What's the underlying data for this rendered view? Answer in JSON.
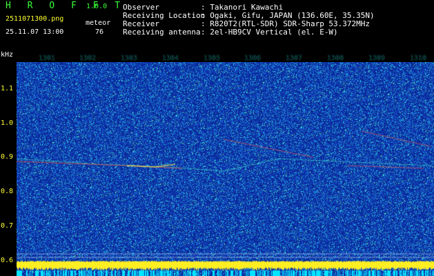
{
  "app": {
    "logo": "H R O F F T",
    "version": "1.0.0",
    "filename": "2511071300.png",
    "datetime": "25.11.07 13:00",
    "meteor_label": "meteor",
    "meteor_count": "76"
  },
  "info": {
    "rows": [
      {
        "label": "Observer",
        "value": "Takanori Kawachi"
      },
      {
        "label": "Receiving Location",
        "value": "Ogaki, Gifu, JAPAN (136.60E, 35.35N)"
      },
      {
        "label": "Receiver",
        "value": "R820T2(RTL-SDR) SDR-Sharp 53.372MHz"
      },
      {
        "label": "Receiving antenna",
        "value": "2el-HB9CV Vertical (el. E-W)"
      }
    ]
  },
  "axis": {
    "unit": "kHz",
    "y_ticks": [
      "1.1",
      "1.0",
      "0.9",
      "0.8",
      "0.7",
      "0.6"
    ],
    "x_ticks": [
      "1301",
      "1302",
      "1303",
      "1304",
      "1305",
      "1306",
      "1307",
      "1308",
      "1309",
      "1310"
    ]
  },
  "colors": {
    "background": "#000000",
    "spectrum_base": "#0a2a9c",
    "header_green": "#39ff39",
    "label_yellow": "#ffff33"
  }
}
